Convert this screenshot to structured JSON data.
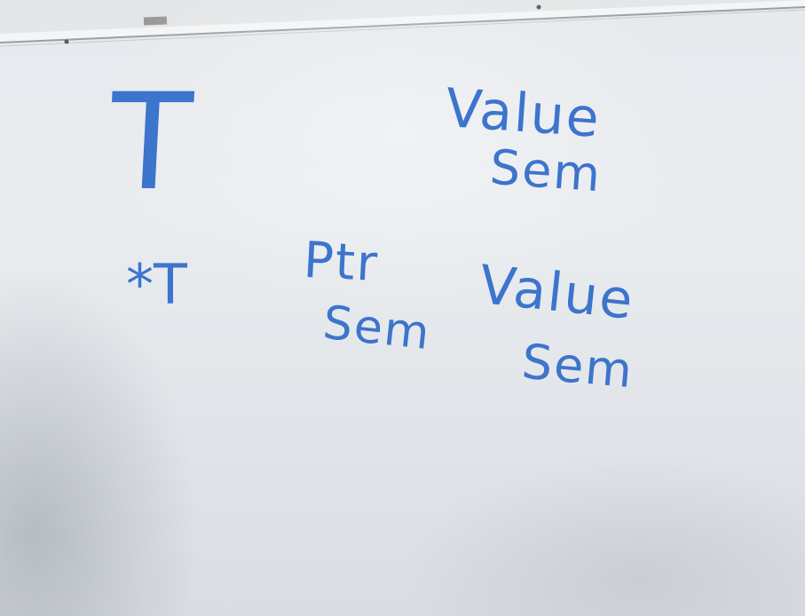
{
  "whiteboard": {
    "row1_type": "T",
    "row1_semantics": [
      "Value",
      "Sem"
    ],
    "row2_type": "*T",
    "row2_ptr_semantics": [
      "Ptr",
      "Sem"
    ],
    "row2_value_semantics": [
      "Value",
      "Sem"
    ]
  },
  "colors": {
    "marker_ink": "#3d74cc",
    "board_white": "#e9ecef",
    "tray_metal": "#f2f3f4"
  }
}
